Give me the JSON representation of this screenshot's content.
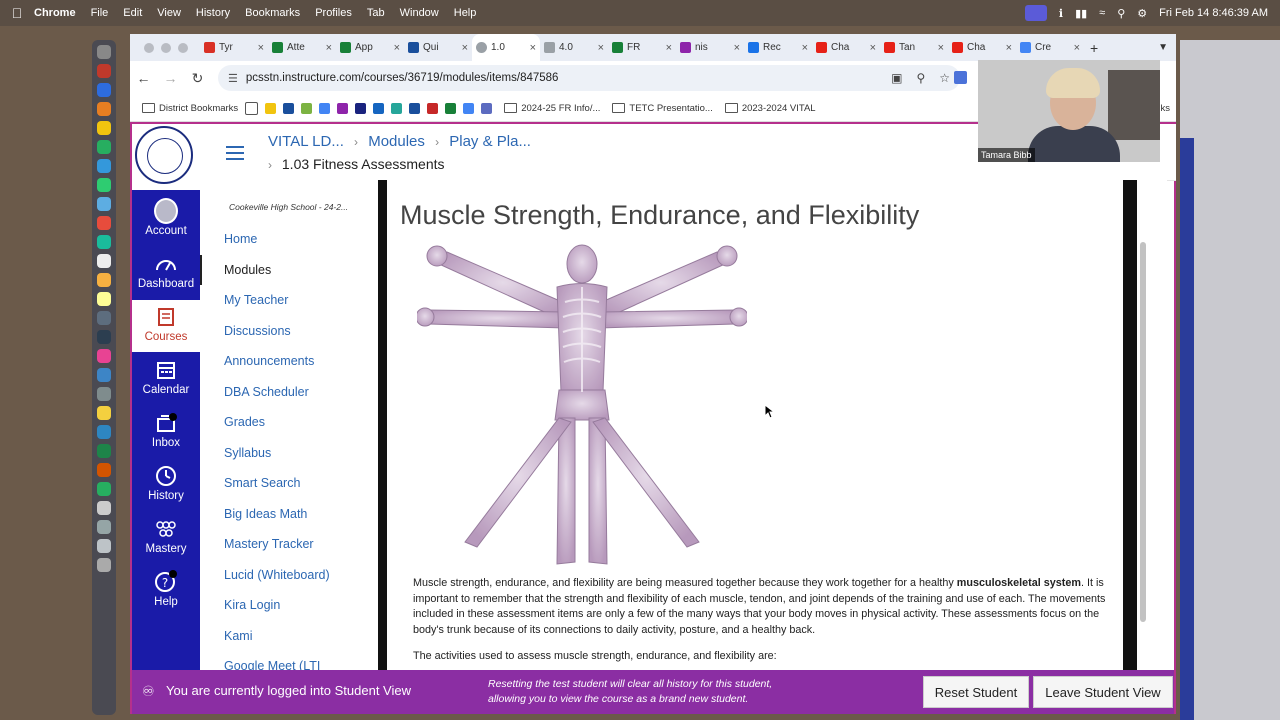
{
  "menubar": {
    "app": "Chrome",
    "items": [
      "File",
      "Edit",
      "View",
      "History",
      "Bookmarks",
      "Profiles",
      "Tab",
      "Window",
      "Help"
    ],
    "clock": "Fri Feb 14  8:46:39 AM"
  },
  "tabs": [
    {
      "label": "Tyr",
      "color": "#d93025"
    },
    {
      "label": "Atte",
      "color": "#188038"
    },
    {
      "label": "App",
      "color": "#188038"
    },
    {
      "label": "Qui",
      "color": "#1a4f9c"
    },
    {
      "label": "1.0",
      "color": "#9aa0a6",
      "active": true
    },
    {
      "label": "4.0",
      "color": "#9aa0a6"
    },
    {
      "label": "FR",
      "color": "#188038"
    },
    {
      "label": "nis",
      "color": "#8e24aa"
    },
    {
      "label": "Rec",
      "color": "#1a73e8"
    },
    {
      "label": "Cha",
      "color": "#e62117"
    },
    {
      "label": "Tan",
      "color": "#e62117"
    },
    {
      "label": "Cha",
      "color": "#e62117"
    },
    {
      "label": "Cre",
      "color": "#4285f4"
    }
  ],
  "address": {
    "url": "pcsstn.instructure.com/courses/36719/modules/items/847586"
  },
  "bookmarks": {
    "district": "District Bookmarks",
    "folders": [
      "2024-25 FR Info/...",
      "TETC Presentatio...",
      "2023-2024 VITAL"
    ],
    "trailing": "ks"
  },
  "global_nav": [
    {
      "label": "Account",
      "icon": "account-avatar-icon"
    },
    {
      "label": "Dashboard",
      "icon": "dashboard-icon"
    },
    {
      "label": "Courses",
      "icon": "courses-icon",
      "active": true
    },
    {
      "label": "Calendar",
      "icon": "calendar-icon"
    },
    {
      "label": "Inbox",
      "icon": "inbox-icon"
    },
    {
      "label": "History",
      "icon": "history-icon"
    },
    {
      "label": "Mastery",
      "icon": "mastery-icon"
    },
    {
      "label": "Help",
      "icon": "help-icon"
    }
  ],
  "breadcrumb": {
    "course": "VITAL LD...",
    "modules": "Modules",
    "module": "Play & Pla...",
    "item": "1.03 Fitness Assessments"
  },
  "course_nav": {
    "school": "Cookeville High School - 24-2...",
    "links": [
      "Home",
      "Modules",
      "My Teacher",
      "Discussions",
      "Announcements",
      "DBA Scheduler",
      "Grades",
      "Syllabus",
      "Smart Search",
      "Big Ideas Math",
      "Mastery Tracker",
      "Lucid (Whiteboard)",
      "Kira Login",
      "Kami",
      "Google Meet (LTI"
    ],
    "active": "Modules"
  },
  "page": {
    "title": "Muscle Strength, Endurance, and Flexibility",
    "para_before_bold": "Muscle strength, endurance, and flexibility are being measured together because they work together for a healthy ",
    "para_bold": "musculoskeletal system",
    "para_after_bold": ". It is important to remember that the strength and flexibility of each muscle, tendon, and joint depends of the training and use of each. The movements included in these assessment items are only a few of the many ways that your body moves in physical activity. These assessments focus on the body's trunk because of its connections to daily activity, posture, and a healthy back.",
    "para2": "The activities used to assess muscle strength, endurance, and flexibility are:"
  },
  "student_view": {
    "message": "You are currently logged into Student View",
    "note_line1": "Resetting the test student will clear all history for this student,",
    "note_line2": "allowing you to view the course as a brand new student.",
    "reset_label": "Reset Student",
    "leave_label": "Leave Student View"
  },
  "video": {
    "name": "Tamara Bibb"
  },
  "colors": {
    "canvas_nav": "#1a1ba8",
    "student_view_bar": "#8b2ea3",
    "link": "#2c67b2"
  }
}
